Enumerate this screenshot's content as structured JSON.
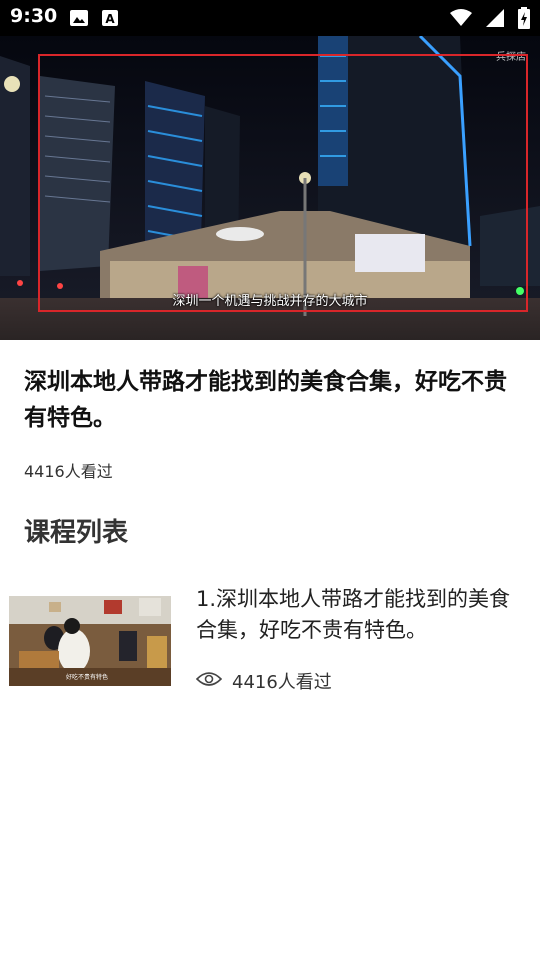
{
  "status_bar": {
    "time": "9:30",
    "icons_left": [
      "image-icon",
      "text-a-icon"
    ],
    "icons_right": [
      "wifi-icon",
      "signal-icon",
      "battery-charging-icon"
    ]
  },
  "video": {
    "subtitle": "深圳一个机遇与挑战并存的大城市",
    "watermark": "兵探店",
    "logo": "bilibili",
    "highlight_color": "#d9262a"
  },
  "course": {
    "title": "深圳本地人带路才能找到的美食合集，好吃不贵有特色。",
    "views": "4416人看过"
  },
  "section": {
    "title": "课程列表"
  },
  "lessons": [
    {
      "index": "1",
      "title": "1.深圳本地人带路才能找到的美食合集，好吃不贵有特色。",
      "views": "4416人看过",
      "thumb_caption": "好吃不贵有特色"
    }
  ]
}
